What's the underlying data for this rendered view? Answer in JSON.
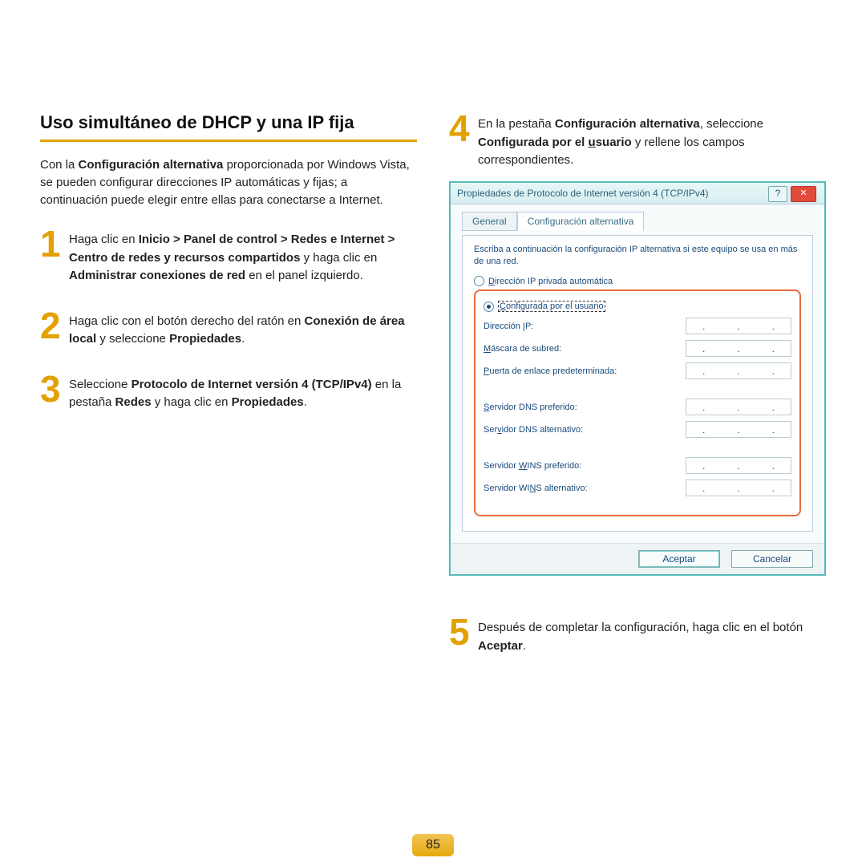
{
  "title": "Uso simultáneo de DHCP y una IP fija",
  "intro_parts": {
    "a": "Con la ",
    "b_bold": "Configuración alternativa",
    "c": " proporcionada por Windows Vista, se pueden configurar direcciones IP automáticas y fijas; a continuación puede elegir entre ellas para conectarse a Internet."
  },
  "steps": {
    "s1": {
      "num": "1",
      "a": "Haga clic en ",
      "b_bold": "Inicio > Panel de control > Redes e Internet > Centro de redes y recursos compartidos",
      "c": " y haga clic en ",
      "d_bold": "Administrar conexiones de red",
      "e": " en el panel izquierdo."
    },
    "s2": {
      "num": "2",
      "a": "Haga clic con el botón derecho del ratón en ",
      "b_bold": "Conexión de área local",
      "c": " y seleccione ",
      "d_bold": "Propiedades",
      "e": "."
    },
    "s3": {
      "num": "3",
      "a": "Seleccione ",
      "b_bold": "Protocolo de Internet versión 4 (TCP/IPv4)",
      "c": " en la pestaña ",
      "d_bold": "Redes",
      "e": " y haga clic en ",
      "f_bold": "Propiedades",
      "g": "."
    },
    "s4": {
      "num": "4",
      "a": "En la pestaña ",
      "b_bold": "Configuración alternativa",
      "c": ", seleccione ",
      "d_bold": "Configurada por el ",
      "d_und": "u",
      "d_bold2": "suario",
      "e": " y rellene los campos correspondientes."
    },
    "s5": {
      "num": "5",
      "a": "Después de completar la configuración, haga clic en el botón ",
      "b_bold": "Aceptar",
      "c": "."
    }
  },
  "dialog": {
    "title": "Propiedades de Protocolo de Internet versión 4 (TCP/IPv4)",
    "help_icon": "?",
    "close_icon": "✕",
    "tabs": {
      "general": "General",
      "alt": "Configuración alternativa"
    },
    "instruction": "Escriba a continuación la configuración IP alternativa si este equipo se usa en más de una red.",
    "radio_auto_pre": "D",
    "radio_auto_post": "irección IP privada automática",
    "radio_user_pre": "C",
    "radio_user_post": "onfigurada por el usuario",
    "fields": {
      "ip_pre": "Dirección ",
      "ip_u": "I",
      "ip_post": "P:",
      "mask_pre": "",
      "mask_u": "M",
      "mask_post": "áscara de subred:",
      "gw_pre": "",
      "gw_u": "P",
      "gw_post": "uerta de enlace predeterminada:",
      "dns1_pre": "",
      "dns1_u": "S",
      "dns1_post": "ervidor DNS preferido:",
      "dns2_pre": "Ser",
      "dns2_u": "v",
      "dns2_post": "idor DNS alternativo:",
      "wins1_pre": "Servidor ",
      "wins1_u": "W",
      "wins1_post": "INS preferido:",
      "wins2_pre": "Servidor WI",
      "wins2_u": "N",
      "wins2_post": "S alternativo:"
    },
    "buttons": {
      "ok": "Aceptar",
      "cancel": "Cancelar"
    }
  },
  "page_number": "85"
}
